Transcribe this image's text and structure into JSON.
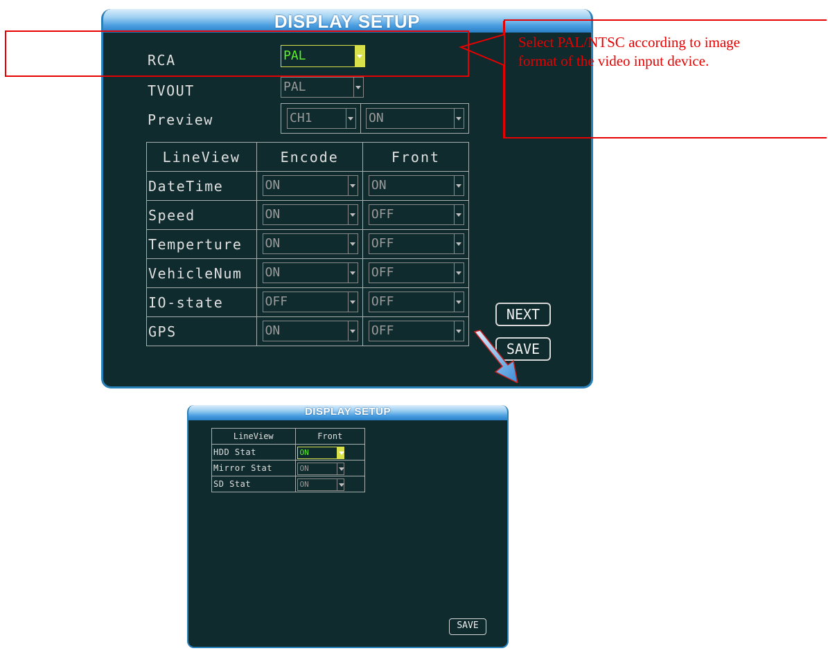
{
  "panel1": {
    "title": "DISPLAY SETUP",
    "rca": {
      "label": "RCA",
      "value": "PAL"
    },
    "tvout": {
      "label": "TVOUT",
      "value": "PAL"
    },
    "preview": {
      "label": "Preview",
      "channel": "CH1",
      "state": "ON"
    },
    "table": {
      "headers": [
        "LineView",
        "Encode",
        "Front"
      ],
      "rows": [
        {
          "name": "DateTime",
          "encode": "ON",
          "front": "ON"
        },
        {
          "name": "Speed",
          "encode": "ON",
          "front": "OFF"
        },
        {
          "name": "Temperture",
          "encode": "ON",
          "front": "OFF"
        },
        {
          "name": "VehicleNum",
          "encode": "ON",
          "front": "OFF"
        },
        {
          "name": "IO-state",
          "encode": "OFF",
          "front": "OFF"
        },
        {
          "name": "GPS",
          "encode": "ON",
          "front": "OFF"
        }
      ]
    },
    "next_label": "NEXT",
    "save_label": "SAVE"
  },
  "annotation": {
    "line1": "Select PAL/NTSC according to image",
    "line2": "format of the video input device."
  },
  "panel2": {
    "title": "DISPLAY SETUP",
    "headers": [
      "LineView",
      "Front"
    ],
    "rows": [
      {
        "name": "HDD Stat",
        "front": "ON"
      },
      {
        "name": "Mirror Stat",
        "front": "ON"
      },
      {
        "name": "SD Stat",
        "front": "ON"
      }
    ],
    "save_label": "SAVE"
  },
  "colors": {
    "panel_bg": "#0f2b2e",
    "title_blue": "#4a9ee0",
    "annotation_red": "#e60000",
    "active_text": "#5df02a",
    "active_border": "#d8e04a"
  }
}
